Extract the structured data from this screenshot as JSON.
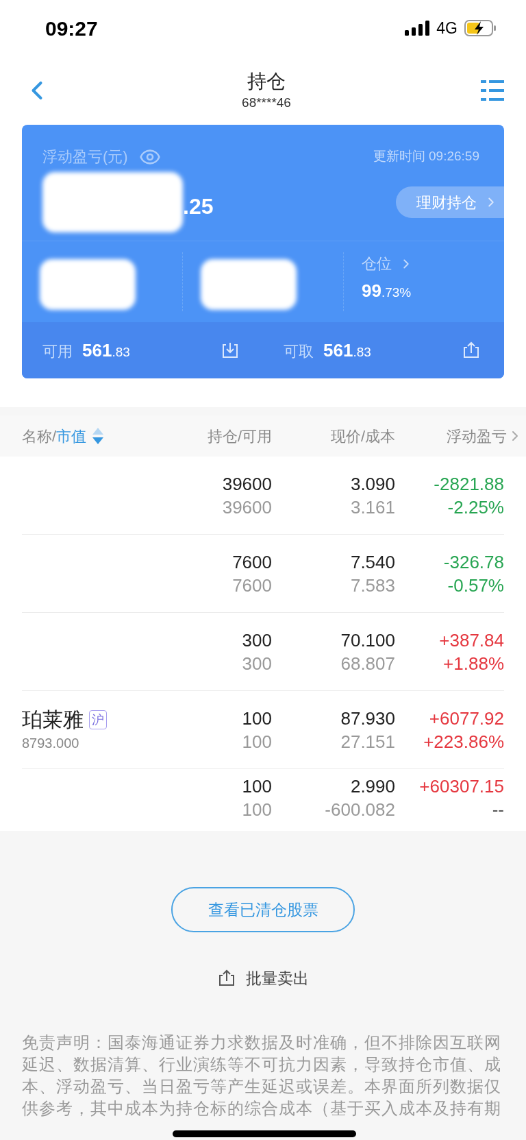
{
  "status_bar": {
    "time": "09:27",
    "network": "4G",
    "charging": true
  },
  "nav": {
    "title": "持仓",
    "account": "68****46"
  },
  "summary": {
    "label": "浮动盈亏(元)",
    "updated": "更新时间 09:26:59",
    "pnl_visible": ".25",
    "wealth_button": "理财持仓",
    "stats": [
      {
        "kind": "redacted"
      },
      {
        "kind": "redacted"
      },
      {
        "kind": "stat",
        "label": "仓位",
        "value_main": "99",
        "value_fraction": ".73%"
      }
    ],
    "funds": [
      {
        "label": "可用",
        "value_main": "561",
        "value_fraction": ".83",
        "kind": "deposit"
      },
      {
        "label": "可取",
        "value_main": "561",
        "value_fraction": ".83",
        "kind": "withdraw"
      }
    ]
  },
  "table": {
    "columns": [
      {
        "label": "名称/",
        "sort_label": "市值",
        "sort_descending": true
      },
      {
        "label": "持仓/可用"
      },
      {
        "label": "现价/成本"
      },
      {
        "label": "浮动盈亏",
        "more": true
      }
    ],
    "rows": [
      {
        "holding": "39600",
        "available": "39600",
        "price": "3.090",
        "cost": "3.161",
        "pnl": {
          "text": "-2821.88",
          "color": "#27a552"
        },
        "pnl_pct": {
          "text": "-2.25%",
          "color": "#27a552"
        }
      },
      {
        "holding": "7600",
        "available": "7600",
        "price": "7.540",
        "cost": "7.583",
        "pnl": {
          "text": "-326.78",
          "color": "#27a552"
        },
        "pnl_pct": {
          "text": "-0.57%",
          "color": "#27a552"
        }
      },
      {
        "holding": "300",
        "available": "300",
        "price": "70.100",
        "cost": "68.807",
        "pnl": {
          "text": "+387.84",
          "color": "#e5373f"
        },
        "pnl_pct": {
          "text": "+1.88%",
          "color": "#e5373f"
        }
      },
      {
        "name": "珀莱雅",
        "market": "沪",
        "market_value": "8793.000",
        "holding": "100",
        "available": "100",
        "price": "87.930",
        "cost": "27.151",
        "pnl": {
          "text": "+6077.92",
          "color": "#e5373f"
        },
        "pnl_pct": {
          "text": "+223.86%",
          "color": "#e5373f"
        }
      },
      {
        "holding": "100",
        "available": "100",
        "price": "2.990",
        "cost": "-600.082",
        "pnl": {
          "text": "+60307.15",
          "color": "#e5373f"
        },
        "pnl_pct": {
          "text": "--",
          "color": "#555555"
        }
      }
    ]
  },
  "cleared_button": "查看已清仓股票",
  "batch_sell": "批量卖出",
  "disclaimer": "免责声明：国泰海通证券力求数据及时准确，但不排除因互联网延迟、数据清算、行业演练等不可抗力因素，导致持仓市值、成本、浮动盈亏、当日盈亏等产生延迟或误差。本界面所列数据仅供参考，其中成本为持仓标的综合成本（基于买入成本及持有期"
}
